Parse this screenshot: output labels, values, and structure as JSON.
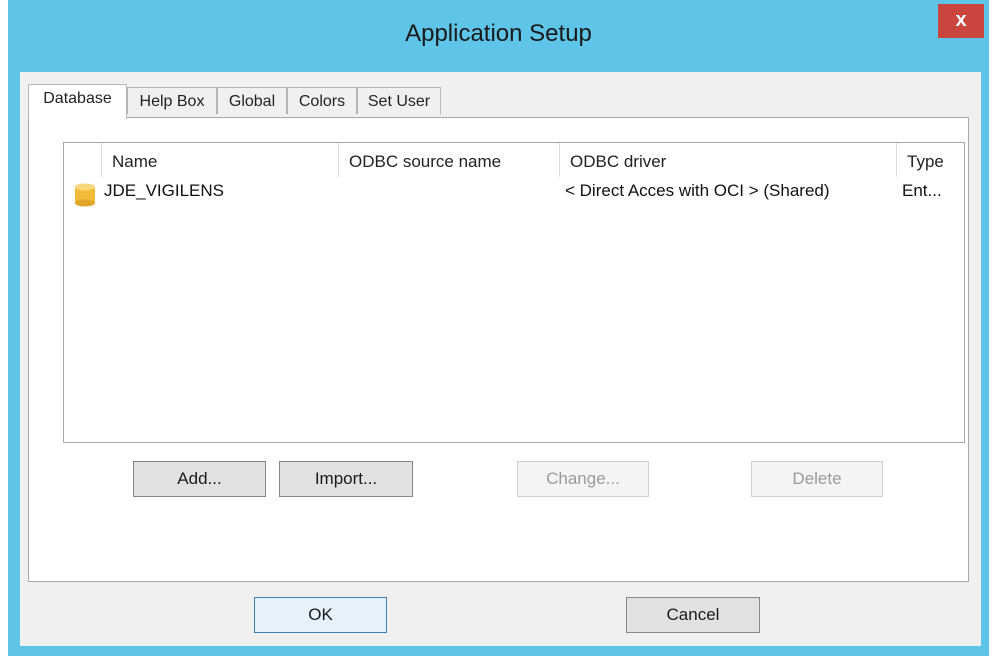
{
  "window": {
    "title": "Application Setup",
    "close_label": "x"
  },
  "tabs": [
    {
      "label": "Database",
      "active": true
    },
    {
      "label": "Help Box",
      "active": false
    },
    {
      "label": "Global",
      "active": false
    },
    {
      "label": "Colors",
      "active": false
    },
    {
      "label": "Set User",
      "active": false
    }
  ],
  "list": {
    "columns": [
      "Name",
      "ODBC source name",
      "ODBC driver",
      "Type"
    ],
    "rows": [
      {
        "name": "JDE_VIGILENS",
        "odbc_source": "",
        "odbc_driver": "< Direct Acces with OCI > (Shared)",
        "type": "Ent...",
        "icon": "database-icon"
      }
    ]
  },
  "panel_buttons": {
    "add": "Add...",
    "import": "Import...",
    "change": "Change...",
    "delete": "Delete"
  },
  "dialog_buttons": {
    "ok": "OK",
    "cancel": "Cancel"
  },
  "colors": {
    "titlebar": "#5ec4e8",
    "close": "#c9453e",
    "db_icon": "#f2bb3a"
  }
}
